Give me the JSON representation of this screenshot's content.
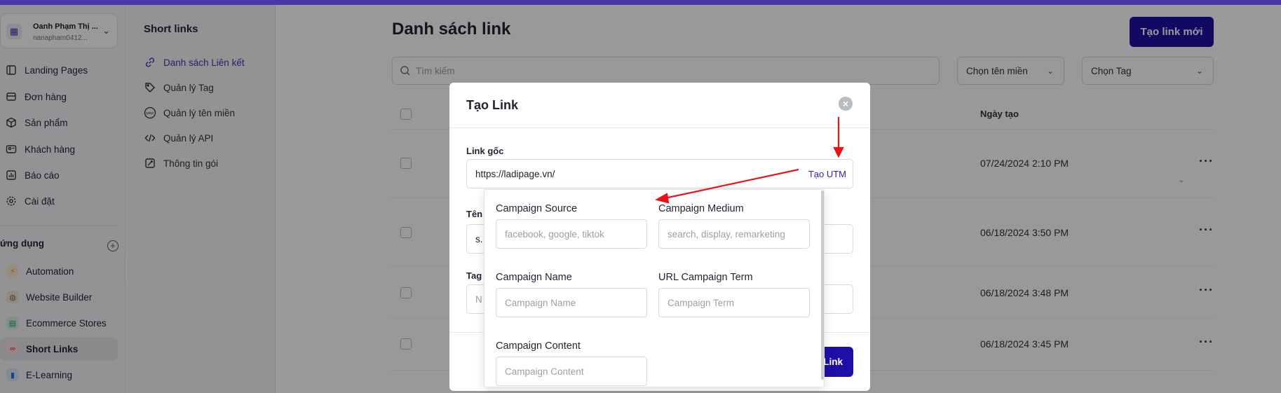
{
  "account": {
    "name": "Oanh Phạm Thị ...",
    "email": "nanapham0412..."
  },
  "nav": [
    {
      "label": "Landing Pages",
      "icon": "landing-pages-icon"
    },
    {
      "label": "Đơn hàng",
      "icon": "orders-icon"
    },
    {
      "label": "Sản phẩm",
      "icon": "box-icon"
    },
    {
      "label": "Khách hàng",
      "icon": "customer-card-icon"
    },
    {
      "label": "Báo cáo",
      "icon": "chart-icon"
    },
    {
      "label": "Cài đặt",
      "icon": "gear-icon"
    }
  ],
  "apps_section": {
    "title": "ứng dụng"
  },
  "apps": [
    {
      "label": "Automation",
      "icon": "lightning-icon",
      "color": "#f08a24"
    },
    {
      "label": "Website Builder",
      "icon": "globe-icon",
      "color": "#8a6d3b"
    },
    {
      "label": "Ecommerce Stores",
      "icon": "store-icon",
      "color": "#22a55a"
    },
    {
      "label": "Short Links",
      "icon": "link-icon",
      "color": "#e5484d",
      "active": true
    },
    {
      "label": "E-Learning",
      "icon": "book-icon",
      "color": "#2f6fd6"
    }
  ],
  "shortlinks_menu": {
    "title": "Short links",
    "items": [
      {
        "label": "Danh sách Liên kết",
        "icon": "link-icon",
        "active": true
      },
      {
        "label": "Quản lý Tag",
        "icon": "tag-icon"
      },
      {
        "label": "Quản lý tên miền",
        "icon": "www-icon"
      },
      {
        "label": "Quản lý API",
        "icon": "code-icon"
      },
      {
        "label": "Thông tin gói",
        "icon": "package-info-icon"
      }
    ]
  },
  "main": {
    "title": "Danh sách link",
    "new_button": "Tạo link mới",
    "search_placeholder": "Tìm kiếm",
    "domain_select": "Chọn tên miền",
    "tag_select": "Chọn Tag",
    "date_header": "Ngày tạo",
    "rows": [
      {
        "date": "07/24/2024 2:10 PM"
      },
      {
        "date": "06/18/2024 3:50 PM"
      },
      {
        "date": "06/18/2024 3:48 PM"
      },
      {
        "date": "06/18/2024 3:45 PM"
      }
    ]
  },
  "modal": {
    "title": "Tạo Link",
    "link_label": "Link gốc",
    "link_value": "https://ladipage.vn/",
    "utm_button": "Tạo UTM",
    "name_label": "Tên",
    "name_value": "s.",
    "tag_label": "Tag",
    "tag_value": "N",
    "submit_partial": "Link"
  },
  "utm": {
    "source_label": "Campaign Source",
    "source_placeholder": "facebook, google, tiktok",
    "medium_label": "Campaign Medium",
    "medium_placeholder": "search, display, remarketing",
    "name_label": "Campaign Name",
    "name_placeholder": "Campaign Name",
    "term_label": "URL Campaign Term",
    "term_placeholder": "Campaign Term",
    "content_label": "Campaign Content",
    "content_placeholder": "Campaign Content"
  },
  "colors": {
    "accent": "#1f0fa6",
    "topbar": "#4b35a8",
    "annotation_arrow": "#e8141a"
  }
}
